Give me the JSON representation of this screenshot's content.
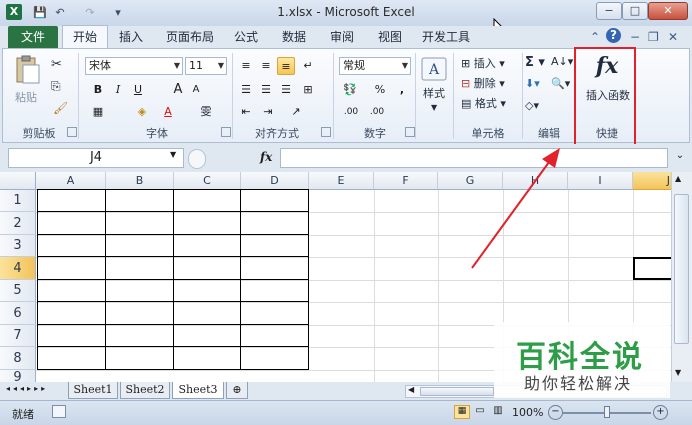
{
  "window": {
    "title": "1.xlsx - Microsoft Excel",
    "app_icon": "X",
    "qat_save": "💾",
    "qat_undo": "↶",
    "qat_redo": "↷",
    "qat_custom": "▾",
    "minimize": "−",
    "maximize": "□",
    "close": "✕"
  },
  "tabs": {
    "file": "文件",
    "items": [
      "开始",
      "插入",
      "页面布局",
      "公式",
      "数据",
      "审阅",
      "视图",
      "开发工具"
    ],
    "active": "开始"
  },
  "ribbon": {
    "clipboard": {
      "paste": "粘贴",
      "label": "剪贴板"
    },
    "font": {
      "name": "宋体",
      "size": "11",
      "label": "字体",
      "bold": "B",
      "italic": "I",
      "underline": "U",
      "grow": "A",
      "shrink": "A",
      "color_letter": "A",
      "phonetic": "雯"
    },
    "alignment": {
      "label": "对齐方式"
    },
    "number": {
      "format": "常规",
      "percent": "%",
      "comma": ",",
      "inc_dec": ".00",
      "label": "数字"
    },
    "styles": {
      "label": "样式"
    },
    "cells": {
      "insert": "插入",
      "delete": "删除",
      "format": "格式",
      "label": "单元格"
    },
    "editing": {
      "sum": "Σ",
      "label": "编辑"
    },
    "quick": {
      "icon_text": "fx",
      "insert_function": "插入函数",
      "label": "快捷"
    }
  },
  "formula_bar": {
    "name_box": "J4",
    "fx": "fx",
    "formula": ""
  },
  "grid": {
    "columns": [
      "A",
      "B",
      "C",
      "D",
      "E",
      "F",
      "G",
      "H",
      "I",
      "J"
    ],
    "rows": [
      "1",
      "2",
      "3",
      "4",
      "5",
      "6",
      "7",
      "8",
      "9"
    ],
    "selected_column": "J",
    "selected_row": "4"
  },
  "sheets": {
    "tabs": [
      "Sheet1",
      "Sheet2",
      "Sheet3"
    ],
    "active": "Sheet3"
  },
  "status": {
    "ready": "就绪",
    "zoom": "100%",
    "zoom_percent": 100
  },
  "watermark": {
    "title": "百科全说",
    "subtitle": "助你轻松解决"
  },
  "colors": {
    "file_tab": "#2a7443",
    "highlight_box": "#e2222a",
    "arrow": "#e2222a",
    "selection": "#f3c35a",
    "watermark": "#2d9e47"
  }
}
